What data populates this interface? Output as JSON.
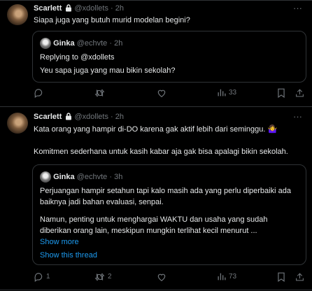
{
  "tweet1": {
    "author": "Scarlett",
    "handle": "@xdollets",
    "time": "2h",
    "text": "Siapa juga yang butuh murid modelan begini?",
    "quote": {
      "author": "Ginka",
      "handle": "@echvte",
      "time": "2h",
      "replying_to": "Replying to @xdollets",
      "text": "Yeu sapa juga yang mau bikin sekolah?"
    },
    "actions": {
      "reply": "",
      "retweet": "",
      "like": "",
      "views": "33"
    }
  },
  "tweet2": {
    "author": "Scarlett",
    "handle": "@xdollets",
    "time": "2h",
    "text1": "Kata orang yang hampir di-DO karena gak aktif lebih dari seminggu. 🤷‍♀️",
    "text2": "Komitmen sederhana untuk kasih kabar aja gak bisa apalagi bikin sekolah.",
    "quote": {
      "author": "Ginka",
      "handle": "@echvte",
      "time": "3h",
      "para1": "Perjuangan hampir setahun tapi kalo masih ada yang perlu diperbaiki ada baiknya jadi bahan evaluasi, senpai.",
      "para2": "Namun, penting untuk menghargai WAKTU dan usaha yang sudah diberikan orang lain, meskipun mungkin terlihat kecil menurut ...",
      "show_more": "Show more",
      "show_thread": "Show this thread"
    },
    "actions": {
      "reply": "1",
      "retweet": "2",
      "like": "",
      "views": "73"
    }
  },
  "separator": "·"
}
